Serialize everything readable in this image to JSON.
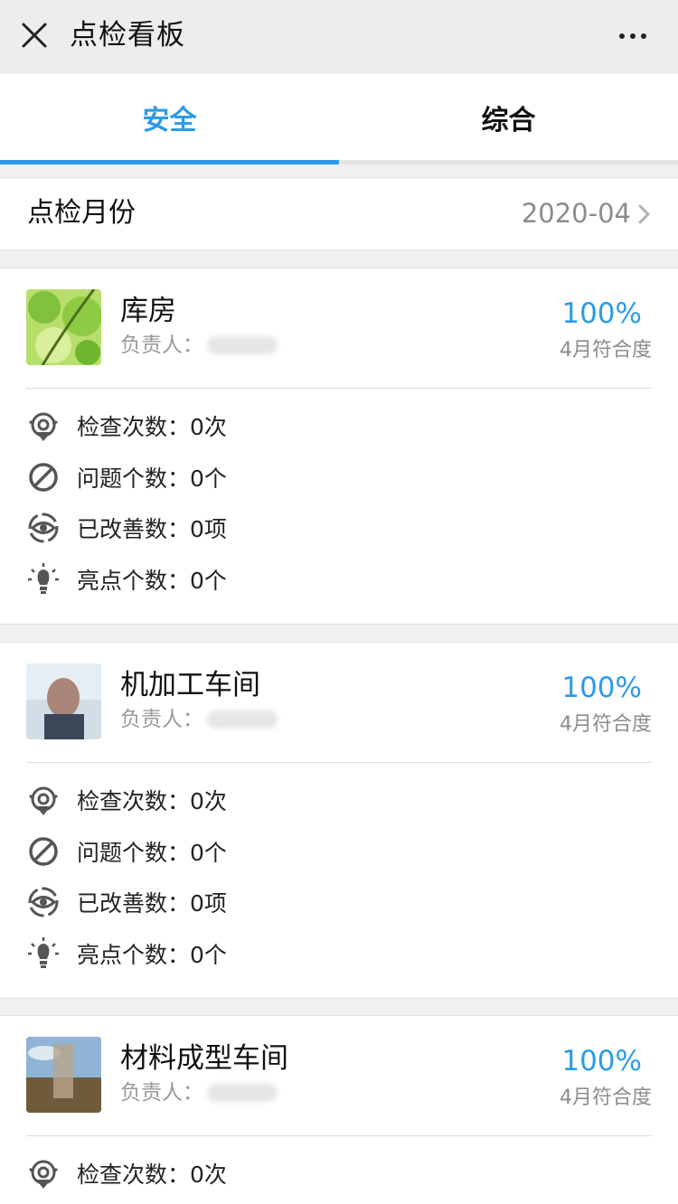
{
  "header": {
    "title": "点检看板"
  },
  "tabs": [
    {
      "label": "安全",
      "active": true
    },
    {
      "label": "综合",
      "active": false
    }
  ],
  "month_row": {
    "label": "点检月份",
    "value": "2020-04"
  },
  "colors": {
    "accent": "#2b9be8",
    "muted": "#8c8c8c"
  },
  "cards": [
    {
      "name": "库房",
      "owner_label": "负责人：",
      "rate": "100%",
      "rate_label": "4月符合度",
      "stats": [
        "检查次数：0次",
        "问题个数：0个",
        "已改善数：0项",
        "亮点个数：0个"
      ]
    },
    {
      "name": "机加工车间",
      "owner_label": "负责人：",
      "rate": "100%",
      "rate_label": "4月符合度",
      "stats": [
        "检查次数：0次",
        "问题个数：0个",
        "已改善数：0项",
        "亮点个数：0个"
      ]
    },
    {
      "name": "材料成型车间",
      "owner_label": "负责人：",
      "rate": "100%",
      "rate_label": "4月符合度",
      "stats": [
        "检查次数：0次"
      ]
    }
  ]
}
